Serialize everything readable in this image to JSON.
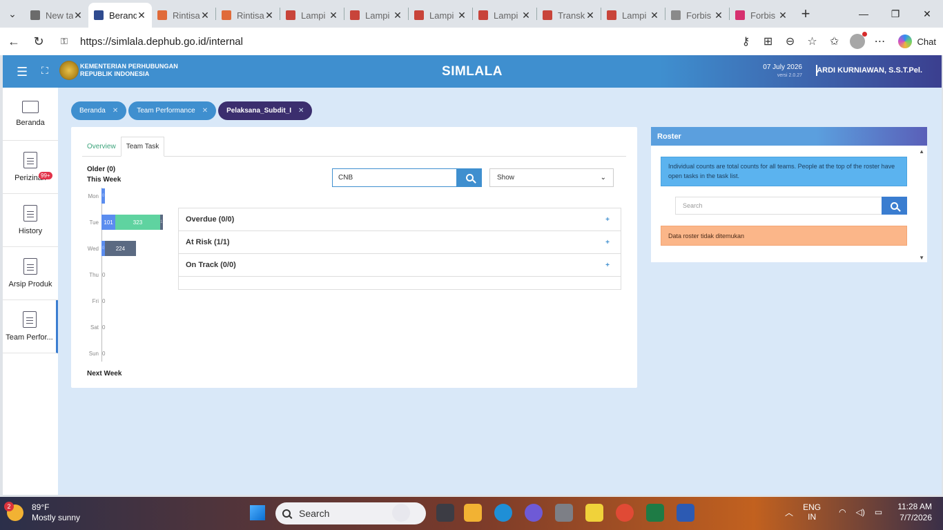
{
  "browser": {
    "tabs": [
      {
        "label": "New ta",
        "favicon_color": "#6b6b6b",
        "active": false
      },
      {
        "label": "Beranda",
        "favicon_color": "#2f4b8f",
        "active": true
      },
      {
        "label": "Rintisa",
        "favicon_color": "#e06b3a",
        "active": false
      },
      {
        "label": "Rintisa",
        "favicon_color": "#e06b3a",
        "active": false
      },
      {
        "label": "Lampi",
        "favicon_color": "#c8443a",
        "active": false
      },
      {
        "label": "Lampi",
        "favicon_color": "#c8443a",
        "active": false
      },
      {
        "label": "Lampi",
        "favicon_color": "#c8443a",
        "active": false
      },
      {
        "label": "Lampi",
        "favicon_color": "#c8443a",
        "active": false
      },
      {
        "label": "Transk",
        "favicon_color": "#c8443a",
        "active": false
      },
      {
        "label": "Lampi",
        "favicon_color": "#c8443a",
        "active": false
      },
      {
        "label": "Forbis",
        "favicon_color": "#8a8a8a",
        "active": false
      },
      {
        "label": "Forbis",
        "favicon_color": "#d6306f",
        "active": false
      }
    ],
    "url": "https://simlala.dephub.go.id/internal",
    "chat_label": "Chat"
  },
  "app": {
    "org_line1": "KEMENTERIAN PERHUBUNGAN",
    "org_line2": "REPUBLIK INDONESIA",
    "title": "SIMLALA",
    "date": "07 July 2026",
    "version": "versi 2.0.27",
    "user": "ARDI KURNIAWAN, S.S.T.Pel."
  },
  "sidebar": {
    "items": [
      {
        "label": "Beranda",
        "icon": "monitor-icon"
      },
      {
        "label": "Perizinan",
        "icon": "document-icon",
        "badge": "99+"
      },
      {
        "label": "History",
        "icon": "document-icon"
      },
      {
        "label": "Arsip Produk",
        "icon": "document-icon"
      },
      {
        "label": "Team Perfor...",
        "icon": "document-icon",
        "active": true
      }
    ]
  },
  "breadcrumbs": [
    {
      "label": "Beranda",
      "active": false
    },
    {
      "label": "Team Performance",
      "active": false
    },
    {
      "label": "Pelaksana_Subdit_I",
      "active": true
    }
  ],
  "panel": {
    "tabs": [
      {
        "label": "Overview",
        "active": false
      },
      {
        "label": "Team Task",
        "active": true
      }
    ],
    "older_label": "Older (0)",
    "this_week_label": "This Week",
    "next_week_label": "Next Week",
    "search_value": "CNB",
    "show_label": "Show",
    "days": [
      {
        "day": "Mon",
        "segments": [
          {
            "value": 0,
            "color": "#5b8def",
            "label": "0"
          }
        ]
      },
      {
        "day": "Tue",
        "segments": [
          {
            "value": 101,
            "color": "#5b8def",
            "label": "101"
          },
          {
            "value": 323,
            "color": "#5fd3a0",
            "label": "323"
          },
          {
            "value": 1,
            "color": "#5b6a82",
            "label": "1"
          }
        ]
      },
      {
        "day": "Wed",
        "segments": [
          {
            "value": 0,
            "color": "#5b8def",
            "label": "0"
          },
          {
            "value": 224,
            "color": "#5b6a82",
            "label": "224"
          }
        ]
      },
      {
        "day": "Thu",
        "zero": "0"
      },
      {
        "day": "Fri",
        "zero": "0"
      },
      {
        "day": "Sat",
        "zero": "0"
      },
      {
        "day": "Sun",
        "zero": "0"
      }
    ],
    "groups": [
      {
        "label": "Overdue (0/0)"
      },
      {
        "label": "At Risk (1/1)"
      },
      {
        "label": "On Track (0/0)"
      }
    ]
  },
  "roster": {
    "title": "Roster",
    "info": "Individual counts are total counts for all teams. People at the top of the roster have open tasks in the task list.",
    "search_placeholder": "Search",
    "alert": "Data roster tidak ditemukan"
  },
  "taskbar": {
    "weather_badge": "2",
    "temperature": "89°F",
    "condition": "Mostly sunny",
    "search_label": "Search",
    "lang_line1": "ENG",
    "lang_line2": "IN",
    "time": "11:28 AM",
    "date": "7/7/2026"
  }
}
